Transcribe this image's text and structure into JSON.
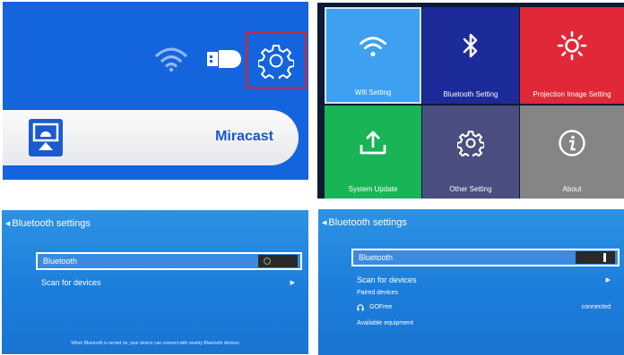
{
  "home": {
    "miracast_label": "Miracast",
    "icons": [
      "wifi-icon",
      "usb-icon",
      "settings-icon",
      "miracast-icon"
    ],
    "highlight_color": "#e02020"
  },
  "settings_menu": {
    "tiles": [
      {
        "label": "Wifi Setting",
        "icon": "wifi-icon",
        "color": "#3da0f0"
      },
      {
        "label": "Bluetooth Setting",
        "icon": "bluetooth-icon",
        "color": "#1d2a9a"
      },
      {
        "label": "Projection Image Setting",
        "icon": "brightness-icon",
        "color": "#e02838"
      },
      {
        "label": "System Update",
        "icon": "upload-icon",
        "color": "#18b456"
      },
      {
        "label": "Other Setting",
        "icon": "gear-icon",
        "color": "#4a4e80"
      },
      {
        "label": "About",
        "icon": "info-icon",
        "color": "#858585"
      }
    ]
  },
  "bt_off": {
    "title": "Bluetooth settings",
    "bluetooth_label": "Bluetooth",
    "toggle_state": "off",
    "scan_label": "Scan for devices",
    "note": "When Bluetooth is turned on, your device can connect with nearby Bluetooth devices"
  },
  "bt_on": {
    "title": "Bluetooth settings",
    "bluetooth_label": "Bluetooth",
    "toggle_state": "on",
    "scan_label": "Scan for devices",
    "paired_header": "Paired devices",
    "device_name": "GOFree",
    "device_status": "connected",
    "available_header": "Available equipment"
  }
}
